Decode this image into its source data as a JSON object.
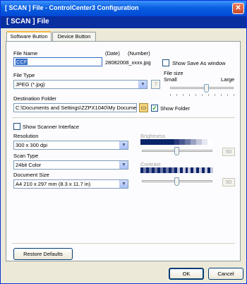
{
  "window": {
    "title": "[ SCAN ]   File - ControlCenter3 Configuration",
    "header": "[ SCAN ]   File"
  },
  "tabs": [
    {
      "label": "Software Button"
    },
    {
      "label": "Device Button"
    }
  ],
  "file_name": {
    "label": "File Name",
    "value": "CCF",
    "date_label": "(Date)",
    "number_label": "(Number)",
    "suffix": "28082008_xxxx.jpg",
    "show_save_as_label": "Show Save As window"
  },
  "file_type": {
    "label": "File Type",
    "value": "JPEG (*.jpg)"
  },
  "file_size": {
    "label": "File size",
    "small": "Small",
    "large": "Large",
    "level_percent": 58
  },
  "destination": {
    "label": "Destination Folder",
    "value": "C:\\Documents and Settings\\ZZPX1040\\My Documents",
    "show_folder_label": "Show Folder",
    "show_folder_checked": true
  },
  "scanner": {
    "show_interface_label": "Show Scanner Interface",
    "show_interface_checked": false
  },
  "resolution": {
    "label": "Resolution",
    "value": "300 x 300 dpi"
  },
  "scan_type": {
    "label": "Scan Type",
    "value": "24bit Color"
  },
  "document_size": {
    "label": "Document Size",
    "value": "A4 210 x 297 mm (8.3 x 11.7 in)"
  },
  "brightness": {
    "label": "Brightness",
    "value": "50",
    "level_percent": 50
  },
  "contrast": {
    "label": "Contrast",
    "value": "50",
    "level_percent": 50
  },
  "buttons": {
    "restore_defaults": "Restore Defaults",
    "ok": "OK",
    "cancel": "Cancel"
  },
  "colors": {
    "title_bar": "#0a5fe0",
    "header_bar": "#0a2fa0",
    "brightness_dark": "#0a246a"
  }
}
